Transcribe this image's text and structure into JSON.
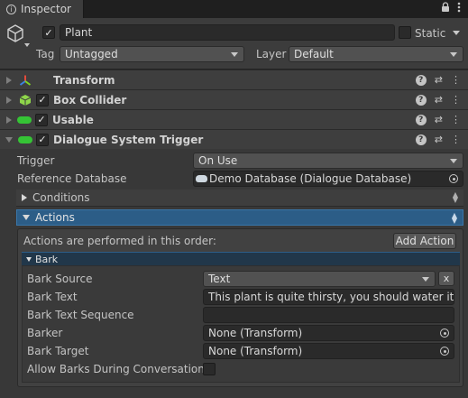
{
  "tab": {
    "label": "Inspector",
    "icon": "info-icon"
  },
  "tab_tools": {
    "lock": "lock-icon",
    "menu": "menu-icon"
  },
  "gameobject": {
    "icon": "cube-icon",
    "active": true,
    "name": "Plant",
    "static_label": "Static",
    "static": false,
    "tag_label": "Tag",
    "tag_value": "Untagged",
    "layer_label": "Layer",
    "layer_value": "Default"
  },
  "components": [
    {
      "name": "Transform",
      "icon": "transform-icon",
      "has_checkbox": false
    },
    {
      "name": "Box Collider",
      "icon": "box-collider-icon",
      "has_checkbox": true,
      "enabled": true
    },
    {
      "name": "Usable",
      "icon": "script-icon",
      "has_checkbox": true,
      "enabled": true
    },
    {
      "name": "Dialogue System Trigger",
      "icon": "script-icon",
      "has_checkbox": true,
      "enabled": true,
      "expanded": true
    }
  ],
  "trigger": {
    "trigger_label": "Trigger",
    "trigger_value": "On Use",
    "db_label": "Reference Database",
    "db_value": "Demo Database (Dialogue Database)",
    "conditions_label": "Conditions",
    "actions_label": "Actions",
    "actions_note": "Actions are performed in this order:",
    "add_action_label": "Add Action"
  },
  "bark": {
    "header": "Bark",
    "source_label": "Bark Source",
    "source_value": "Text",
    "remove_label": "x",
    "text_label": "Bark Text",
    "text_value": "This plant is quite thirsty, you should water it.",
    "sequence_label": "Bark Text Sequence",
    "sequence_value": "",
    "barker_label": "Barker",
    "barker_value": "None (Transform)",
    "target_label": "Bark Target",
    "target_value": "None (Transform)",
    "allow_label": "Allow Barks During Conversations",
    "allow_value": false
  },
  "colors": {
    "accent": "#2c5d87",
    "box_collider_icon": "#8fd64a",
    "script_icon": "#35c435",
    "transform_red": "#e24b3b",
    "transform_green": "#7ed321",
    "transform_blue": "#3b82e2"
  }
}
